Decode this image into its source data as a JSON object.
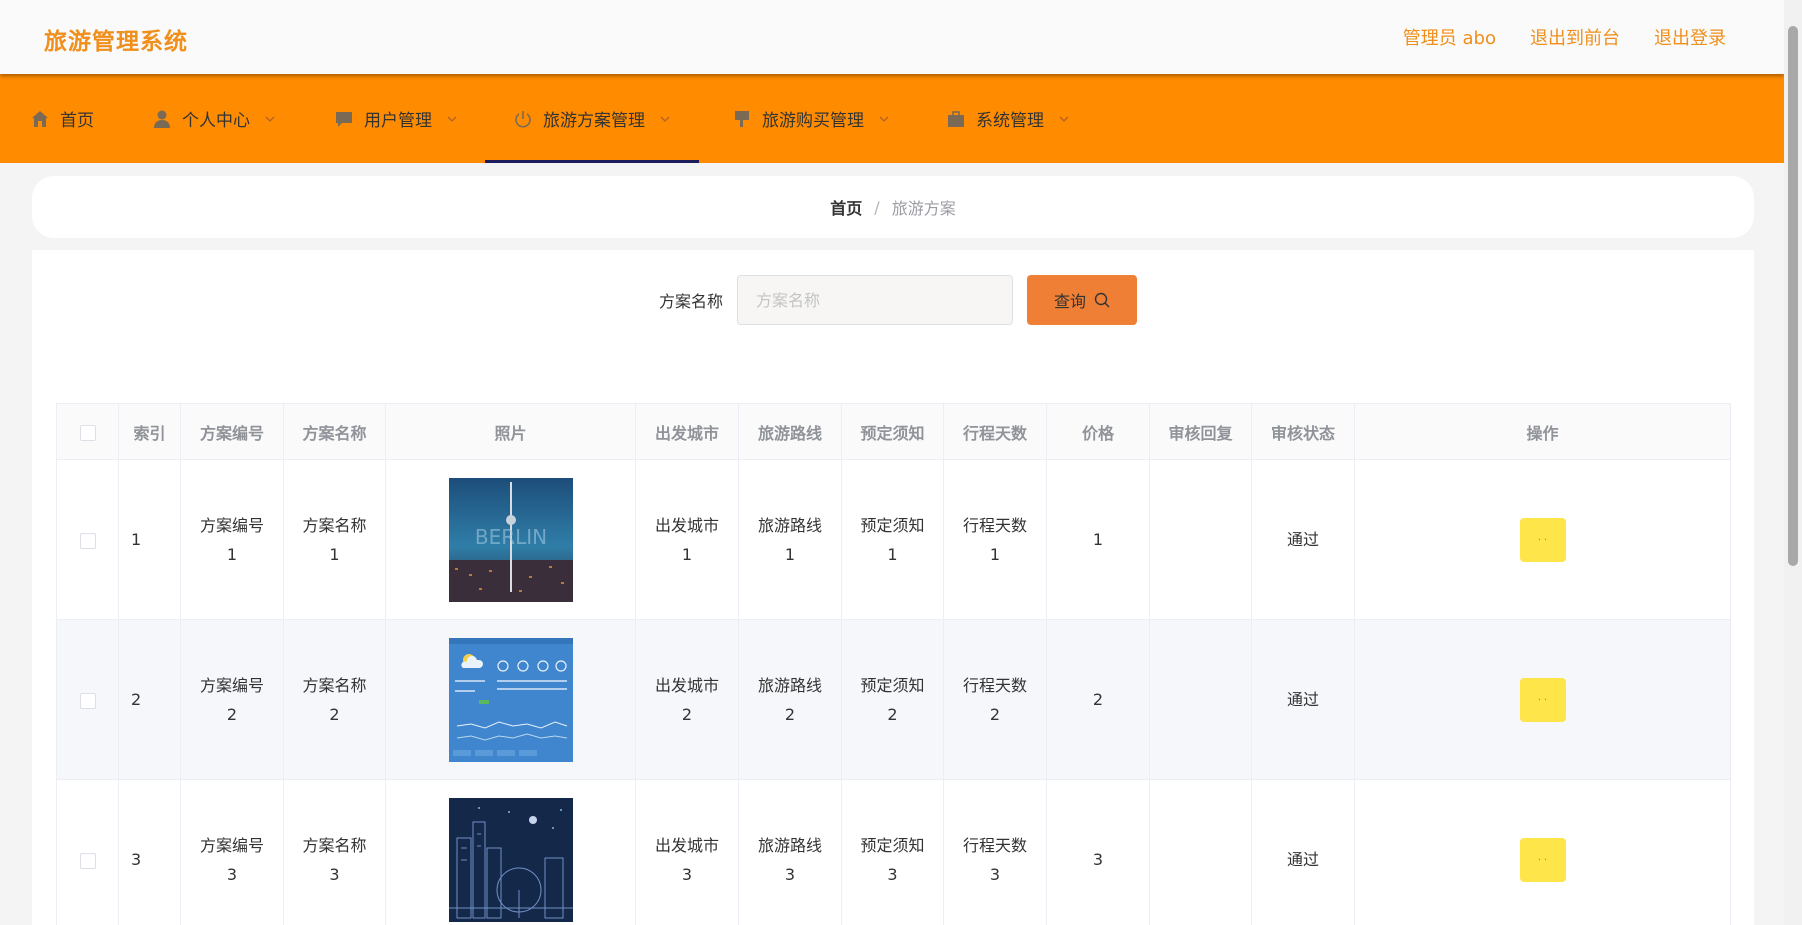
{
  "header": {
    "brand": "旅游管理系统",
    "role_label": "管理员 abo",
    "front_link": "退出到前台",
    "logout_link": "退出登录"
  },
  "nav": {
    "items": [
      {
        "label": "首页",
        "icon": "home-icon",
        "has_dropdown": false
      },
      {
        "label": "个人中心",
        "icon": "user-icon",
        "has_dropdown": true
      },
      {
        "label": "用户管理",
        "icon": "chat-icon",
        "has_dropdown": true
      },
      {
        "label": "旅游方案管理",
        "icon": "power-icon",
        "has_dropdown": true,
        "active": true
      },
      {
        "label": "旅游购买管理",
        "icon": "flag-icon",
        "has_dropdown": true
      },
      {
        "label": "系统管理",
        "icon": "briefcase-icon",
        "has_dropdown": true
      }
    ]
  },
  "breadcrumb": {
    "home": "首页",
    "separator": "/",
    "current": "旅游方案"
  },
  "search": {
    "label": "方案名称",
    "placeholder": "方案名称",
    "value": "",
    "button_label": "查询"
  },
  "table": {
    "headers": [
      "索引",
      "方案编号",
      "方案名称",
      "照片",
      "出发城市",
      "旅游路线",
      "预定须知",
      "行程天数",
      "价格",
      "审核回复",
      "审核状态",
      "操作"
    ],
    "rows": [
      {
        "index": "1",
        "plan_no": [
          "方案编号",
          "1"
        ],
        "plan_name": [
          "方案名称",
          "1"
        ],
        "photo": "city-night-tower",
        "city": [
          "出发城市",
          "1"
        ],
        "route": [
          "旅游路线",
          "1"
        ],
        "notice": [
          "预定须知",
          "1"
        ],
        "days": [
          "行程天数",
          "1"
        ],
        "price": "1",
        "reply": "",
        "status": "通过",
        "op_label": "· ·"
      },
      {
        "index": "2",
        "plan_no": [
          "方案编号",
          "2"
        ],
        "plan_name": [
          "方案名称",
          "2"
        ],
        "photo": "weather-forecast",
        "city": [
          "出发城市",
          "2"
        ],
        "route": [
          "旅游路线",
          "2"
        ],
        "notice": [
          "预定须知",
          "2"
        ],
        "days": [
          "行程天数",
          "2"
        ],
        "price": "2",
        "reply": "",
        "status": "通过",
        "op_label": "· ·"
      },
      {
        "index": "3",
        "plan_no": [
          "方案编号",
          "3"
        ],
        "plan_name": [
          "方案名称",
          "3"
        ],
        "photo": "city-line-art",
        "city": [
          "出发城市",
          "3"
        ],
        "route": [
          "旅游路线",
          "3"
        ],
        "notice": [
          "预定须知",
          "3"
        ],
        "days": [
          "行程天数",
          "3"
        ],
        "price": "3",
        "reply": "",
        "status": "通过",
        "op_label": "· ·"
      }
    ]
  },
  "colors": {
    "brand": "#f08f1c",
    "nav_bg": "#ff8c00",
    "nav_active_underline": "#1d1d5c",
    "search_button": "#ef7f35",
    "op_button": "#fde54a"
  }
}
